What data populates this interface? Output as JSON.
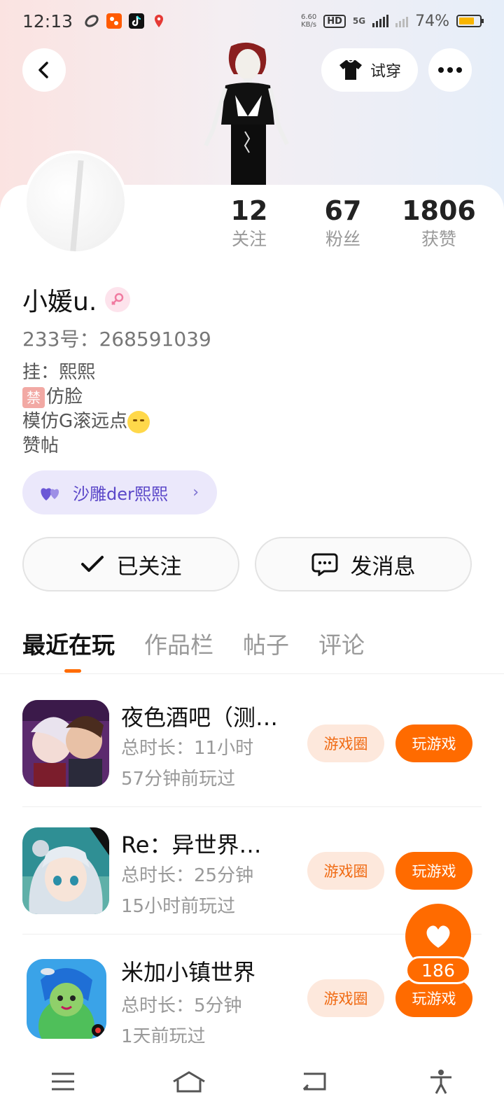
{
  "status_bar": {
    "time": "12:13",
    "net_speed_value": "6.60",
    "net_speed_unit": "KB/s",
    "hd_label": "HD",
    "network_type": "5G",
    "battery_percent": "74%",
    "battery_level": 0.74,
    "app_icons": [
      "link-app-icon",
      "taobao-app-icon",
      "tiktok-app-icon",
      "location-app-icon"
    ]
  },
  "header": {
    "back_icon": "chevron-left-icon",
    "try_on_label": "试穿",
    "more_icon": "more-dots-icon"
  },
  "profile": {
    "stats": [
      {
        "value": "12",
        "label": "关注"
      },
      {
        "value": "67",
        "label": "粉丝"
      },
      {
        "value": "1806",
        "label": "获赞"
      }
    ],
    "name": "小媛u.",
    "gender_icon": "female-icon",
    "uid": "233号：268591039",
    "bio_lines": {
      "line1": "挂：熙熙",
      "ban_tag": "禁",
      "line2": "仿脸",
      "line3": "模仿G滚远点",
      "line4": "赞帖"
    },
    "club_label": "沙雕der熙熙",
    "club_chevron": "›"
  },
  "actions": {
    "follow_label": "已关注",
    "message_label": "发消息"
  },
  "tabs": [
    {
      "label": "最近在玩",
      "active": true
    },
    {
      "label": "作品栏",
      "active": false
    },
    {
      "label": "帖子",
      "active": false
    },
    {
      "label": "评论",
      "active": false
    }
  ],
  "games": [
    {
      "title": "夜色酒吧（测…",
      "duration": "总时长：11小时",
      "last_played": "57分钟前玩过",
      "circle_label": "游戏圈",
      "play_label": "玩游戏"
    },
    {
      "title": "Re：异世界…",
      "duration": "总时长：25分钟",
      "last_played": "15小时前玩过",
      "circle_label": "游戏圈",
      "play_label": "玩游戏"
    },
    {
      "title": "米加小镇世界",
      "duration": "总时长：5分钟",
      "last_played": "1天前玩过",
      "circle_label": "游戏圈",
      "play_label": "玩游戏"
    }
  ],
  "floating_like": {
    "icon": "heart-icon",
    "count": "186"
  },
  "nav": {
    "items": [
      "menu-icon",
      "home-icon",
      "back-icon",
      "accessibility-icon"
    ]
  },
  "colors": {
    "accent": "#ff6b00",
    "club_text": "#5b47c9",
    "club_bg": "#ebe8fb"
  }
}
